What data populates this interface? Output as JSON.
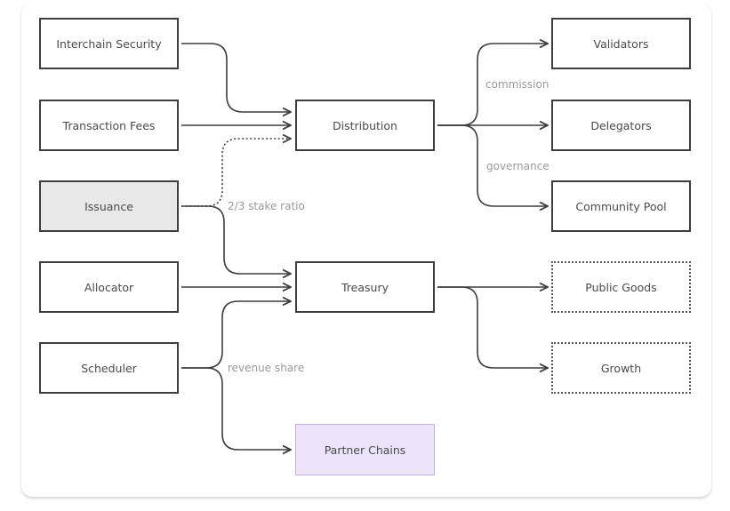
{
  "nodes": {
    "interchain_security": {
      "label": "Interchain Security",
      "style": "solid"
    },
    "transaction_fees": {
      "label": "Transaction Fees",
      "style": "solid"
    },
    "issuance": {
      "label": "Issuance",
      "style": "gray-fill"
    },
    "allocator": {
      "label": "Allocator",
      "style": "solid"
    },
    "scheduler": {
      "label": "Scheduler",
      "style": "solid"
    },
    "distribution": {
      "label": "Distribution",
      "style": "solid"
    },
    "treasury": {
      "label": "Treasury",
      "style": "solid"
    },
    "partner_chains": {
      "label": "Partner Chains",
      "style": "purple-fill"
    },
    "validators": {
      "label": "Validators",
      "style": "solid"
    },
    "delegators": {
      "label": "Delegators",
      "style": "solid"
    },
    "community_pool": {
      "label": "Community Pool",
      "style": "solid"
    },
    "public_goods": {
      "label": "Public Goods",
      "style": "dotted"
    },
    "growth": {
      "label": "Growth",
      "style": "dotted"
    }
  },
  "edges": [
    {
      "from": "Interchain Security",
      "to": "Distribution",
      "style": "solid"
    },
    {
      "from": "Transaction Fees",
      "to": "Distribution",
      "style": "solid"
    },
    {
      "from": "Issuance",
      "to": "Distribution",
      "style": "dotted",
      "label": "2/3 stake ratio"
    },
    {
      "from": "Issuance",
      "to": "Treasury",
      "style": "solid"
    },
    {
      "from": "Allocator",
      "to": "Treasury",
      "style": "solid"
    },
    {
      "from": "Scheduler",
      "to": "Treasury",
      "style": "solid",
      "label": "revenue share"
    },
    {
      "from": "Scheduler",
      "to": "Partner Chains",
      "style": "solid"
    },
    {
      "from": "Distribution",
      "to": "Validators",
      "style": "solid",
      "label": "commission"
    },
    {
      "from": "Distribution",
      "to": "Delegators",
      "style": "solid"
    },
    {
      "from": "Distribution",
      "to": "Community Pool",
      "style": "solid",
      "label": "governance"
    },
    {
      "from": "Treasury",
      "to": "Public Goods",
      "style": "solid"
    },
    {
      "from": "Treasury",
      "to": "Growth",
      "style": "solid"
    }
  ],
  "edge_labels": {
    "stake_ratio": "2/3 stake ratio",
    "revenue_share": "revenue share",
    "commission": "commission",
    "governance": "governance"
  },
  "colors": {
    "stroke": "#3d3d3d",
    "gray_fill": "#e8e8e8",
    "purple_fill": "#ede3fb",
    "purple_border": "#c6aee6",
    "label_text": "#9a9a9a"
  }
}
